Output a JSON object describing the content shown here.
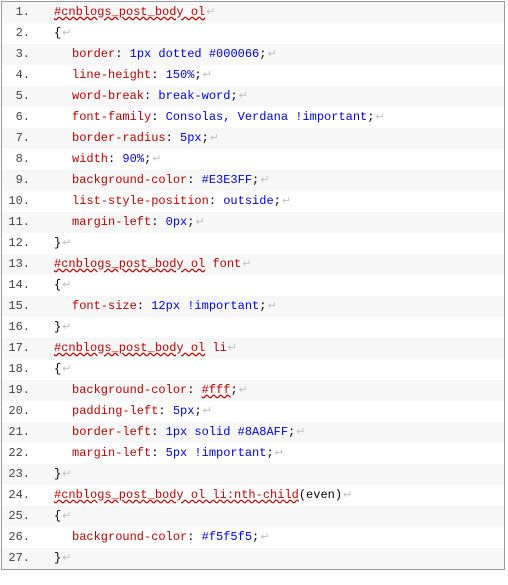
{
  "code": {
    "lines": [
      {
        "n": "1.",
        "indent": 1,
        "tokens": [
          {
            "c": "t-link",
            "t": "#cnblogs_post_body ol"
          },
          {
            "c": "crlf",
            "t": "↵"
          }
        ]
      },
      {
        "n": "2.",
        "indent": 1,
        "tokens": [
          {
            "c": "t-pn",
            "t": "{"
          },
          {
            "c": "crlf",
            "t": "↵"
          }
        ]
      },
      {
        "n": "3.",
        "indent": 2,
        "tokens": [
          {
            "c": "t-prop",
            "t": "border"
          },
          {
            "c": "t-pn",
            "t": ": "
          },
          {
            "c": "t-val",
            "t": "1px dotted #000066"
          },
          {
            "c": "t-pn",
            "t": ";"
          },
          {
            "c": "crlf",
            "t": "↵"
          }
        ]
      },
      {
        "n": "4.",
        "indent": 2,
        "tokens": [
          {
            "c": "t-prop",
            "t": "line-height"
          },
          {
            "c": "t-pn",
            "t": ": "
          },
          {
            "c": "t-val",
            "t": "150%"
          },
          {
            "c": "t-pn",
            "t": ";"
          },
          {
            "c": "crlf",
            "t": "↵"
          }
        ]
      },
      {
        "n": "5.",
        "indent": 2,
        "tokens": [
          {
            "c": "t-prop",
            "t": "word-break"
          },
          {
            "c": "t-pn",
            "t": ": "
          },
          {
            "c": "t-val",
            "t": "break-word"
          },
          {
            "c": "t-pn",
            "t": ";"
          },
          {
            "c": "crlf",
            "t": "↵"
          }
        ]
      },
      {
        "n": "6.",
        "indent": 2,
        "tokens": [
          {
            "c": "t-prop",
            "t": "font-family"
          },
          {
            "c": "t-pn",
            "t": ": "
          },
          {
            "c": "t-val",
            "t": "Consolas, Verdana !important"
          },
          {
            "c": "t-pn",
            "t": ";"
          },
          {
            "c": "crlf",
            "t": "↵"
          }
        ]
      },
      {
        "n": "7.",
        "indent": 2,
        "tokens": [
          {
            "c": "t-prop",
            "t": "border-radius"
          },
          {
            "c": "t-pn",
            "t": ": "
          },
          {
            "c": "t-val",
            "t": "5px"
          },
          {
            "c": "t-pn",
            "t": ";"
          },
          {
            "c": "crlf",
            "t": "↵"
          }
        ]
      },
      {
        "n": "8.",
        "indent": 2,
        "tokens": [
          {
            "c": "t-prop",
            "t": "width"
          },
          {
            "c": "t-pn",
            "t": ": "
          },
          {
            "c": "t-val",
            "t": "90%"
          },
          {
            "c": "t-pn",
            "t": ";"
          },
          {
            "c": "crlf",
            "t": "↵"
          }
        ]
      },
      {
        "n": "9.",
        "indent": 2,
        "tokens": [
          {
            "c": "t-prop",
            "t": "background-color"
          },
          {
            "c": "t-pn",
            "t": ": "
          },
          {
            "c": "t-val",
            "t": "#E3E3FF"
          },
          {
            "c": "t-pn",
            "t": ";"
          },
          {
            "c": "crlf",
            "t": "↵"
          }
        ]
      },
      {
        "n": "10.",
        "indent": 2,
        "tokens": [
          {
            "c": "t-prop",
            "t": "list-style-position"
          },
          {
            "c": "t-pn",
            "t": ": "
          },
          {
            "c": "t-val",
            "t": "outside"
          },
          {
            "c": "t-pn",
            "t": ";"
          },
          {
            "c": "crlf",
            "t": "↵"
          }
        ]
      },
      {
        "n": "11.",
        "indent": 2,
        "tokens": [
          {
            "c": "t-prop",
            "t": "margin-left"
          },
          {
            "c": "t-pn",
            "t": ": "
          },
          {
            "c": "t-val",
            "t": "0px"
          },
          {
            "c": "t-pn",
            "t": ";"
          },
          {
            "c": "crlf",
            "t": "↵"
          }
        ]
      },
      {
        "n": "12.",
        "indent": 1,
        "tokens": [
          {
            "c": "t-pn",
            "t": "}"
          },
          {
            "c": "crlf",
            "t": "↵"
          }
        ]
      },
      {
        "n": "13.",
        "indent": 1,
        "tokens": [
          {
            "c": "t-link",
            "t": "#cnblogs_post_body ol"
          },
          {
            "c": "t-sel",
            "t": " font"
          },
          {
            "c": "crlf",
            "t": "↵"
          }
        ]
      },
      {
        "n": "14.",
        "indent": 1,
        "tokens": [
          {
            "c": "t-pn",
            "t": "{"
          },
          {
            "c": "crlf",
            "t": "↵"
          }
        ]
      },
      {
        "n": "15.",
        "indent": 2,
        "tokens": [
          {
            "c": "t-prop",
            "t": "font-size"
          },
          {
            "c": "t-pn",
            "t": ": "
          },
          {
            "c": "t-val",
            "t": "12px !important"
          },
          {
            "c": "t-pn",
            "t": ";"
          },
          {
            "c": "crlf",
            "t": "↵"
          }
        ]
      },
      {
        "n": "16.",
        "indent": 1,
        "tokens": [
          {
            "c": "t-pn",
            "t": "}"
          },
          {
            "c": "crlf",
            "t": "↵"
          }
        ]
      },
      {
        "n": "17.",
        "indent": 1,
        "tokens": [
          {
            "c": "t-link",
            "t": "#cnblogs_post_body ol"
          },
          {
            "c": "t-sel",
            "t": " li"
          },
          {
            "c": "crlf",
            "t": "↵"
          }
        ]
      },
      {
        "n": "18.",
        "indent": 1,
        "tokens": [
          {
            "c": "t-pn",
            "t": "{"
          },
          {
            "c": "crlf",
            "t": "↵"
          }
        ]
      },
      {
        "n": "19.",
        "indent": 2,
        "tokens": [
          {
            "c": "t-prop",
            "t": "background-color"
          },
          {
            "c": "t-pn",
            "t": ": "
          },
          {
            "c": "t-link",
            "t": "#fff"
          },
          {
            "c": "t-pn",
            "t": ";"
          },
          {
            "c": "crlf",
            "t": "↵"
          }
        ]
      },
      {
        "n": "20.",
        "indent": 2,
        "tokens": [
          {
            "c": "t-prop",
            "t": "padding-left"
          },
          {
            "c": "t-pn",
            "t": ": "
          },
          {
            "c": "t-val",
            "t": "5px"
          },
          {
            "c": "t-pn",
            "t": ";"
          },
          {
            "c": "crlf",
            "t": "↵"
          }
        ]
      },
      {
        "n": "21.",
        "indent": 2,
        "tokens": [
          {
            "c": "t-prop",
            "t": "border-left"
          },
          {
            "c": "t-pn",
            "t": ": "
          },
          {
            "c": "t-val",
            "t": "1px solid #8A8AFF"
          },
          {
            "c": "t-pn",
            "t": ";"
          },
          {
            "c": "crlf",
            "t": "↵"
          }
        ]
      },
      {
        "n": "22.",
        "indent": 2,
        "tokens": [
          {
            "c": "t-prop",
            "t": "margin-left"
          },
          {
            "c": "t-pn",
            "t": ": "
          },
          {
            "c": "t-val",
            "t": "5px !important"
          },
          {
            "c": "t-pn",
            "t": ";"
          },
          {
            "c": "crlf",
            "t": "↵"
          }
        ]
      },
      {
        "n": "23.",
        "indent": 1,
        "tokens": [
          {
            "c": "t-pn",
            "t": "}"
          },
          {
            "c": "crlf",
            "t": "↵"
          }
        ]
      },
      {
        "n": "24.",
        "indent": 1,
        "tokens": [
          {
            "c": "t-link",
            "t": "#cnblogs_post_body ol li:nth-child"
          },
          {
            "c": "t-pn",
            "t": "("
          },
          {
            "c": "t-pn",
            "t": "even"
          },
          {
            "c": "t-pn",
            "t": ")"
          },
          {
            "c": "crlf",
            "t": "↵"
          }
        ]
      },
      {
        "n": "25.",
        "indent": 1,
        "tokens": [
          {
            "c": "t-pn",
            "t": "{"
          },
          {
            "c": "crlf",
            "t": "↵"
          }
        ]
      },
      {
        "n": "26.",
        "indent": 2,
        "tokens": [
          {
            "c": "t-prop",
            "t": "background-color"
          },
          {
            "c": "t-pn",
            "t": ": "
          },
          {
            "c": "t-val",
            "t": "#f5f5f5"
          },
          {
            "c": "t-pn",
            "t": ";"
          },
          {
            "c": "crlf",
            "t": "↵"
          }
        ]
      },
      {
        "n": "27.",
        "indent": 1,
        "tokens": [
          {
            "c": "t-pn",
            "t": "}"
          },
          {
            "c": "crlf",
            "t": "↵"
          }
        ]
      }
    ]
  }
}
